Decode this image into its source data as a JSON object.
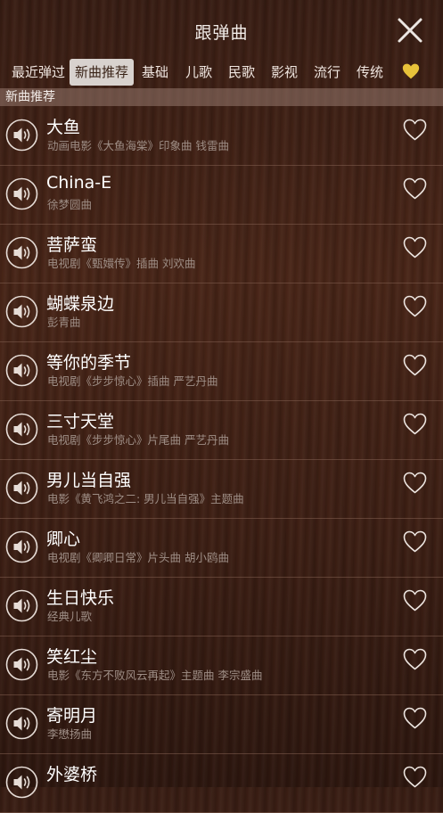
{
  "header": {
    "title": "跟弹曲"
  },
  "tabs": [
    {
      "label": "最近弹过"
    },
    {
      "label": "新曲推荐"
    },
    {
      "label": "基础"
    },
    {
      "label": "儿歌"
    },
    {
      "label": "民歌"
    },
    {
      "label": "影视"
    },
    {
      "label": "流行"
    },
    {
      "label": "传统"
    }
  ],
  "active_tab": "新曲推荐",
  "section": {
    "title": "新曲推荐"
  },
  "songs": [
    {
      "title": "大鱼",
      "subtitle": "动画电影《大鱼海棠》印象曲 钱雷曲"
    },
    {
      "title": "China-E",
      "subtitle": "徐梦圆曲"
    },
    {
      "title": "菩萨蛮",
      "subtitle": "电视剧《甄嬛传》插曲 刘欢曲"
    },
    {
      "title": "蝴蝶泉边",
      "subtitle": "彭青曲"
    },
    {
      "title": "等你的季节",
      "subtitle": "电视剧《步步惊心》插曲 严艺丹曲"
    },
    {
      "title": "三寸天堂",
      "subtitle": "电视剧《步步惊心》片尾曲 严艺丹曲"
    },
    {
      "title": "男儿当自强",
      "subtitle": "电影《黄飞鸿之二: 男儿当自强》主题曲"
    },
    {
      "title": "卿心",
      "subtitle": "电视剧《卿卿日常》片头曲 胡小鸥曲"
    },
    {
      "title": "生日快乐",
      "subtitle": "经典儿歌"
    },
    {
      "title": "笑红尘",
      "subtitle": "电影《东方不败风云再起》主题曲 李宗盛曲"
    },
    {
      "title": "寄明月",
      "subtitle": "李懋扬曲"
    },
    {
      "title": "外婆桥",
      "subtitle": ""
    }
  ],
  "colors": {
    "favorites_heart": "#e8c23a",
    "background": "#3f2016"
  },
  "icons": {
    "close": "close-icon",
    "favorites": "heart-icon",
    "play": "speaker-icon",
    "favorite": "heart-outline-icon"
  }
}
